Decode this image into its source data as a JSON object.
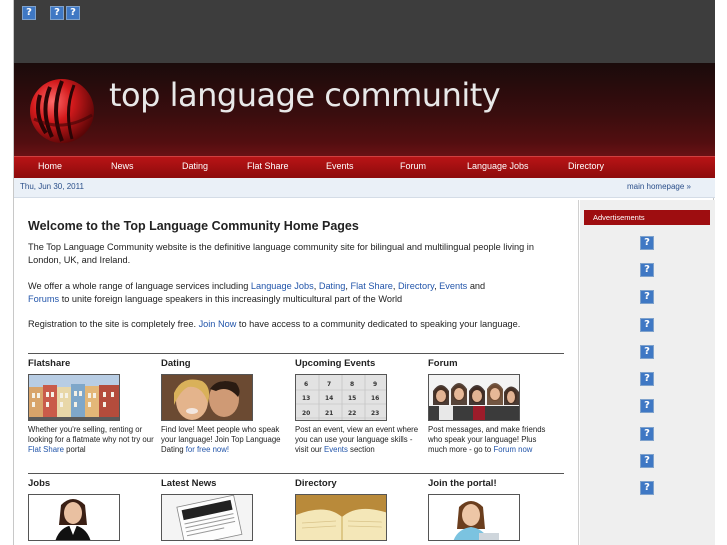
{
  "header": {
    "icons": [
      "help-icon",
      "help-icon",
      "help-icon"
    ],
    "site_title": "top language community"
  },
  "nav": {
    "items": [
      "Home",
      "News",
      "Dating",
      "Flat Share",
      "Events",
      "Forum",
      "Language Jobs",
      "Directory"
    ]
  },
  "datebar": {
    "date": "Thu, Jun 30, 2011",
    "main_homepage": "main homepage »"
  },
  "main": {
    "heading": "Welcome to the Top Language Community Home Pages",
    "intro": "The Top Language Community website is the definitive language community site for bilingual and multilingual people living in London, UK, and Ireland.",
    "services": {
      "prefix": "We offer a whole range of language services including ",
      "link_jobs": "Language Jobs",
      "sep1": ", ",
      "link_dating": "Dating",
      "sep2": ", ",
      "link_flatshare": "Flat Share",
      "sep3": ", ",
      "link_directory": "Directory",
      "sep4": ", ",
      "link_events": "Events",
      "and": " and",
      "link_forums": "Forums",
      "suffix": " to unite foreign language speakers in this increasingly multicultural part of the World"
    },
    "registration": {
      "prefix": "Registration to the site is completely free. ",
      "link_join": "Join Now",
      "suffix": " to have access to a community dedicated to speaking your language."
    },
    "sections_row1": [
      {
        "title": "Flatshare",
        "text": "Whether you're selling, renting or looking for a flatmate why not try our ",
        "link": "Flat Share",
        "after": " portal"
      },
      {
        "title": "Dating",
        "text": "Find love! Meet people who speak your language! Join Top Language Dating ",
        "link": "for free now!",
        "after": ""
      },
      {
        "title": "Upcoming Events",
        "text": "Post an event, view an event where you can use your language skills - visit our ",
        "link": "Events",
        "after": " section"
      },
      {
        "title": "Forum",
        "text": "Post messages, and make friends who speak your language! Plus much more - go to ",
        "link": "Forum now",
        "after": ""
      }
    ],
    "sections_row2": [
      {
        "title": "Jobs"
      },
      {
        "title": "Latest News"
      },
      {
        "title": "Directory"
      },
      {
        "title": "Join the portal!"
      }
    ],
    "calendar_numbers": [
      "6",
      "7",
      "8",
      "9",
      "13",
      "14",
      "15",
      "16",
      "20",
      "21",
      "22",
      "23"
    ]
  },
  "sidebar": {
    "ads_label": "Advertisements",
    "ad_icons": [
      "help-icon",
      "help-icon",
      "help-icon",
      "help-icon",
      "help-icon",
      "help-icon",
      "help-icon",
      "help-icon",
      "help-icon",
      "help-icon"
    ]
  },
  "colors": {
    "nav_red": "#a31012",
    "link_blue": "#2255aa",
    "topbar": "#3d3d3d"
  }
}
